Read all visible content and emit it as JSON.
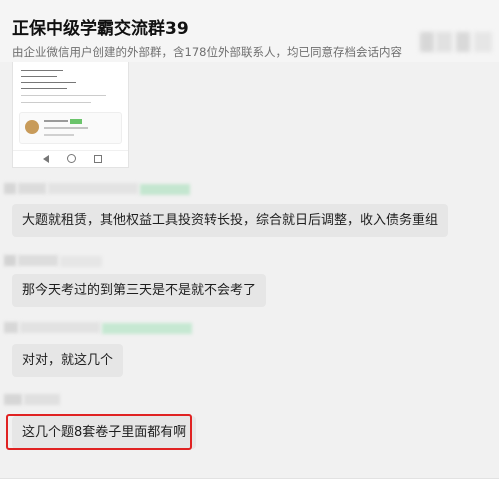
{
  "header": {
    "title": "正保中级学霸交流群39",
    "subtitle": "由企业微信用户创建的外部群，含178位外部联系人，均已同意存档会话内容"
  },
  "attachment": {
    "type": "image",
    "nav_icons": [
      "back-triangle-icon",
      "home-circle-icon",
      "recents-square-icon"
    ]
  },
  "messages": [
    {
      "text": "大题就租赁，其他权益工具投资转长投，综合就日后调整，收入债务重组"
    },
    {
      "text": "那今天考过的到第三天是不是就不会考了"
    },
    {
      "text": "对对，就这几个"
    },
    {
      "text": "这几个题8套卷子里面都有啊",
      "highlighted": true
    }
  ],
  "colors": {
    "background": "#f1f1f1",
    "bubble": "#e6e6e6",
    "highlight_border": "#e02222",
    "blurred_name_green": "#c4e6cf"
  }
}
